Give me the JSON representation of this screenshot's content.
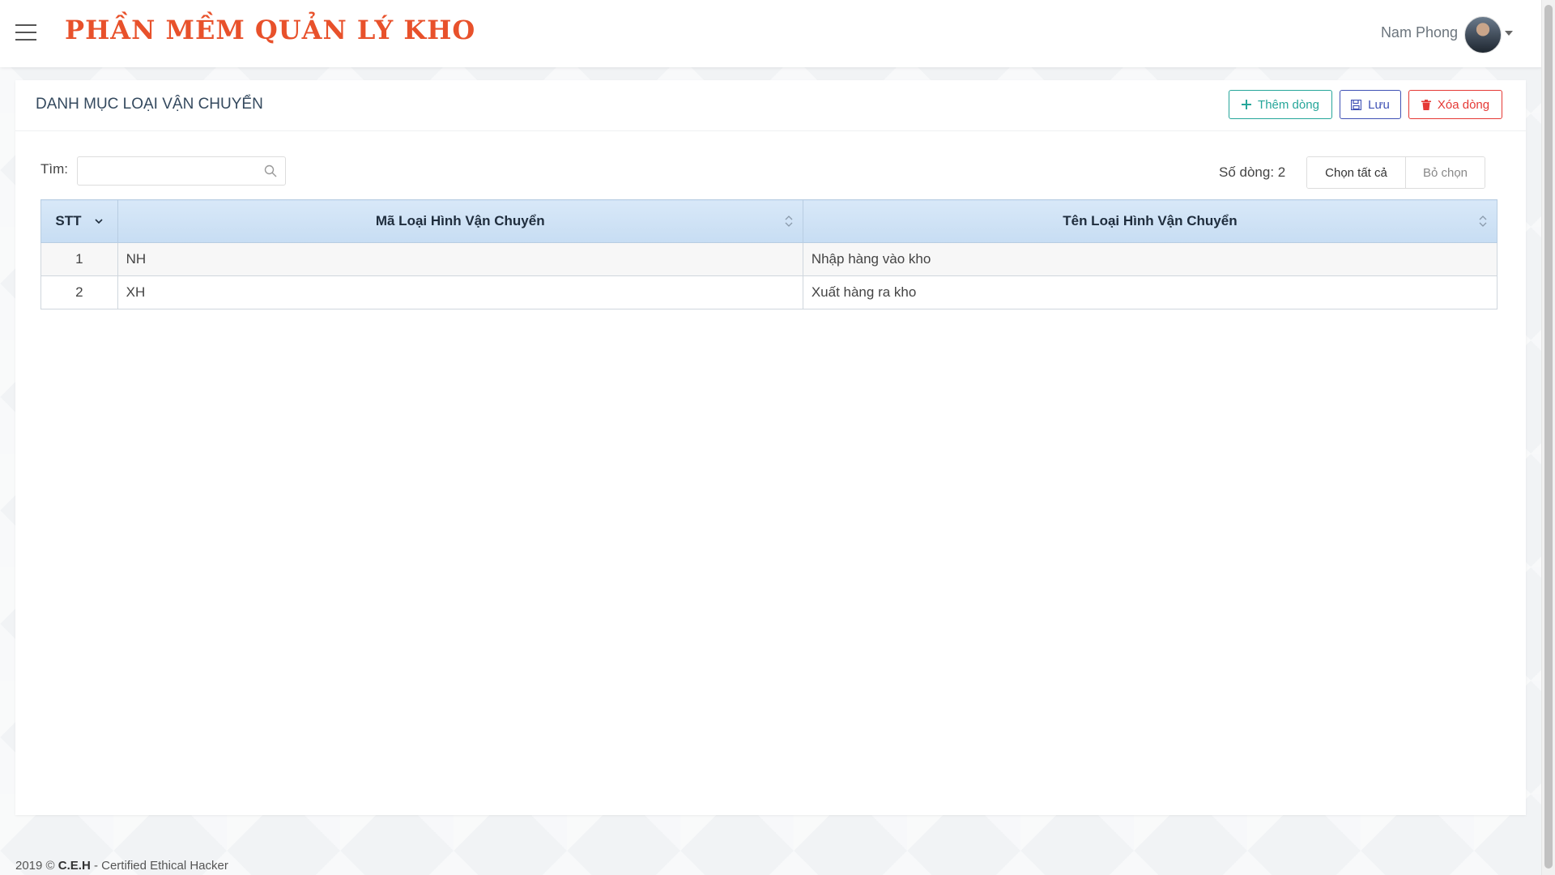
{
  "header": {
    "brand": "PHẦN MỀM QUẢN LÝ KHO",
    "user_name": "Nam Phong"
  },
  "card": {
    "title": "DANH MỤC LOẠI VẬN CHUYỂN",
    "buttons": {
      "add": "Thêm dòng",
      "save": "Lưu",
      "delete": "Xóa dòng"
    }
  },
  "toolbar": {
    "search_label": "Tìm:",
    "search_value": "",
    "search_placeholder": "",
    "row_count": "Số dòng: 2",
    "select_all": "Chọn tất cả",
    "deselect": "Bỏ chọn"
  },
  "table": {
    "columns": [
      "STT",
      "Mã Loại Hình Vận Chuyển",
      "Tên Loại Hình Vận Chuyển"
    ],
    "rows": [
      {
        "stt": "1",
        "code": "NH",
        "name": "Nhập hàng vào kho"
      },
      {
        "stt": "2",
        "code": "XH",
        "name": "Xuất hàng ra kho"
      }
    ]
  },
  "footer": {
    "prefix": "2019 © ",
    "org": "C.E.H",
    "suffix": " - Certified Ethical Hacker"
  },
  "colors": {
    "brand": "#e8512b",
    "add": "#26a69a",
    "save": "#3f51b5",
    "delete": "#e53935",
    "header_bg": "#d2e4f6"
  },
  "icons": {
    "menu": "hamburger-icon",
    "search": "search-icon",
    "add": "plus-icon",
    "save": "floppy-disk-icon",
    "delete": "trash-icon",
    "sort": "sort-icon",
    "user_menu": "caret-down-icon"
  }
}
